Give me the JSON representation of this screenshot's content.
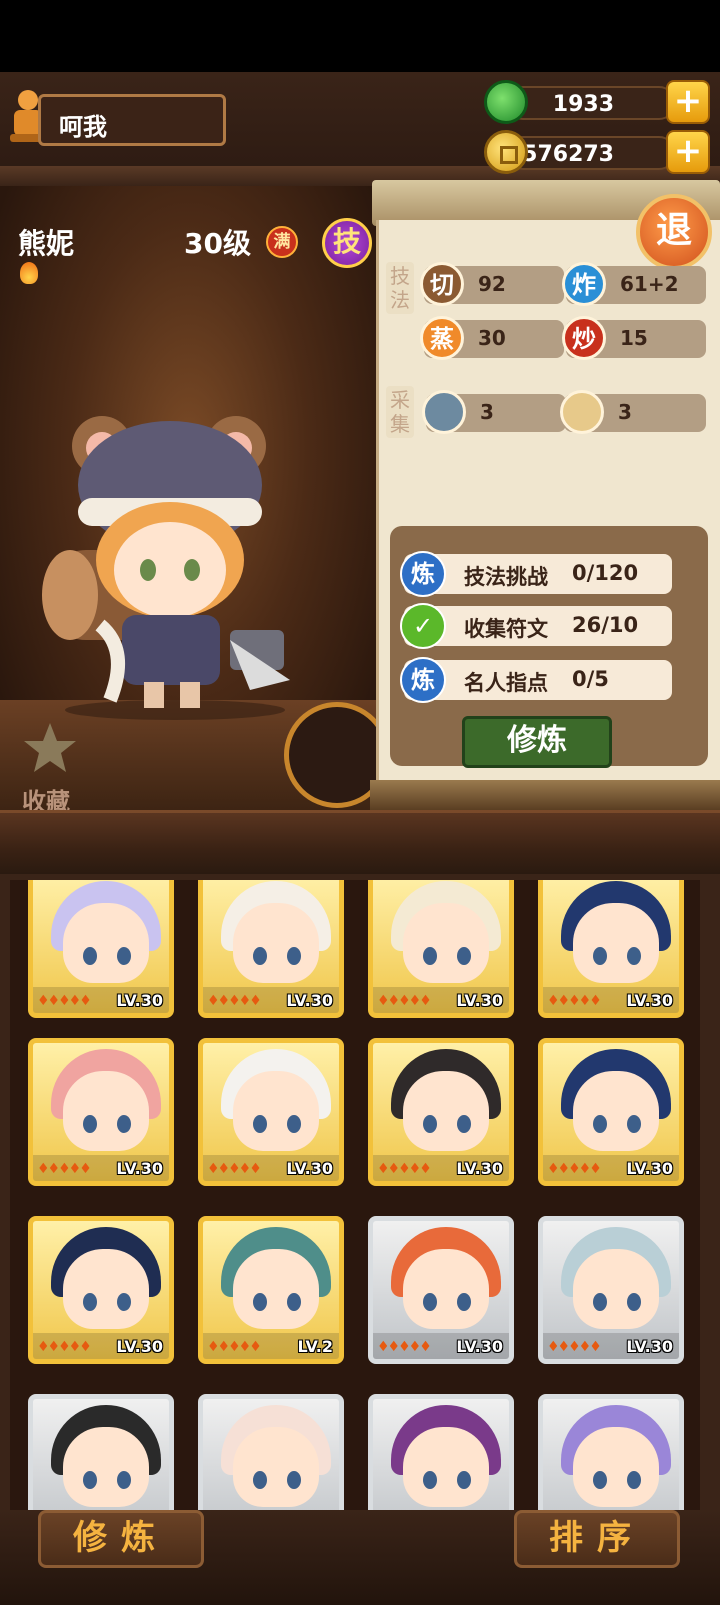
{
  "player": {
    "name": "呵我"
  },
  "resources": {
    "jade": "1933",
    "coins": "576273",
    "plus": "+"
  },
  "character": {
    "name": "熊妮",
    "level": "30级",
    "max_badge": "满",
    "skill_badge": "技"
  },
  "favorite": {
    "label": "收藏"
  },
  "panel": {
    "exit_label": "退",
    "technique_label": "技法",
    "gather_label": "采集",
    "skills": [
      {
        "icon": "切",
        "value": "92"
      },
      {
        "icon": "炸",
        "value": "61+2"
      },
      {
        "icon": "蒸",
        "value": "30"
      },
      {
        "icon": "炒",
        "value": "15"
      }
    ],
    "gathering": [
      {
        "icon": "fish-icon",
        "value": "3"
      },
      {
        "icon": "bun-icon",
        "value": "3"
      }
    ],
    "tasks": [
      {
        "icon": "炼",
        "label": "技法挑战",
        "value": "0/120"
      },
      {
        "icon": "check-icon",
        "label": "收集符文",
        "value": "26/10"
      },
      {
        "icon": "炼",
        "label": "名人指点",
        "value": "0/5"
      }
    ],
    "train_button": "修炼"
  },
  "cards": [
    {
      "level": "LV.30",
      "tier": "gold",
      "hair": "#c9c3f0"
    },
    {
      "level": "LV.30",
      "tier": "gold",
      "hair": "#f5efe6"
    },
    {
      "level": "LV.30",
      "tier": "gold",
      "hair": "#f4ead3"
    },
    {
      "level": "LV.30",
      "tier": "gold",
      "hair": "#22386e"
    },
    {
      "level": "LV.30",
      "tier": "gold",
      "hair": "#f0a4a0"
    },
    {
      "level": "LV.30",
      "tier": "gold",
      "hair": "#f4f2ee"
    },
    {
      "level": "LV.30",
      "tier": "gold",
      "hair": "#2f2a2a"
    },
    {
      "level": "LV.30",
      "tier": "gold",
      "hair": "#22386e"
    },
    {
      "level": "LV.30",
      "tier": "gold",
      "hair": "#1f2d52"
    },
    {
      "level": "LV.2",
      "tier": "gold",
      "hair": "#4f8e8a"
    },
    {
      "level": "LV.30",
      "tier": "silver",
      "hair": "#e86a3a"
    },
    {
      "level": "LV.30",
      "tier": "silver",
      "hair": "#b9cfd6"
    },
    {
      "level": "",
      "tier": "silver",
      "hair": "#2a2a2a"
    },
    {
      "level": "",
      "tier": "silver",
      "hair": "#f6e0d6"
    },
    {
      "level": "",
      "tier": "silver",
      "hair": "#7a3a8a"
    },
    {
      "level": "",
      "tier": "silver",
      "hair": "#9a86d8"
    }
  ],
  "bottom": {
    "left_button": "修炼",
    "right_button": "排序"
  }
}
